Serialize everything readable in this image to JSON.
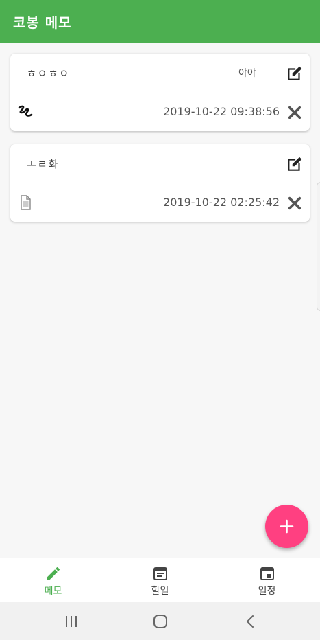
{
  "app": {
    "title": "코봉 메모"
  },
  "memos": [
    {
      "title": "ㅎㅇㅎㅇ",
      "extra": "야야",
      "date": "2019-10-22 09:38:56",
      "type_icon": "handwriting-icon"
    },
    {
      "title": "ㅗㄹ화",
      "extra": "",
      "date": "2019-10-22 02:25:42",
      "type_icon": "document-icon"
    }
  ],
  "fab": {
    "icon": "plus-icon"
  },
  "bottom_nav": {
    "items": [
      {
        "label": "메모",
        "icon": "pencil-icon",
        "active": true
      },
      {
        "label": "할일",
        "icon": "list-icon",
        "active": false
      },
      {
        "label": "일정",
        "icon": "calendar-icon",
        "active": false
      }
    ]
  },
  "system_nav": {
    "buttons": [
      "recent-apps-icon",
      "home-icon",
      "back-icon"
    ]
  },
  "colors": {
    "primary": "#4caf50",
    "accent": "#ff4081",
    "background": "#f7f7f7"
  }
}
